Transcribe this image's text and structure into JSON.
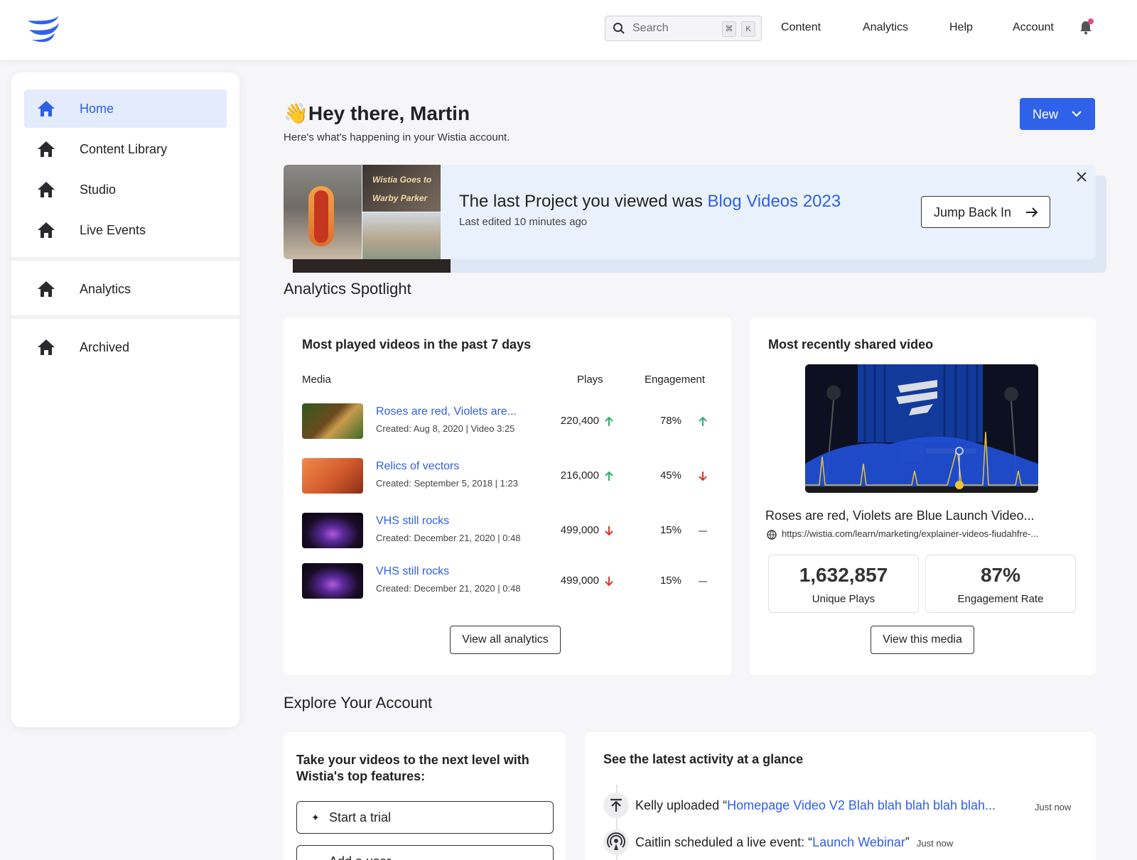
{
  "header": {
    "search": {
      "placeholder": "Search",
      "key1": "⌘",
      "key2": "K"
    },
    "nav": [
      "Content",
      "Analytics",
      "Help",
      "Account"
    ],
    "icons": [
      "wistia-logo-icon",
      "search-icon",
      "bell-icon"
    ]
  },
  "sidebar": {
    "items": [
      {
        "label": "Home",
        "active": true
      },
      {
        "label": "Content Library"
      },
      {
        "label": "Studio"
      },
      {
        "label": "Live Events"
      },
      {
        "label": "Analytics"
      },
      {
        "label": "Archived"
      }
    ]
  },
  "greeting": {
    "emoji": "👋",
    "title": "Hey there, Martin",
    "subtitle": "Here's what's happening in your Wistia account.",
    "new_label": "New"
  },
  "banner": {
    "text": "The last Project you viewed was ",
    "project_link": "Blog Videos 2023",
    "edited": "Last edited 10 minutes ago",
    "button": "Jump Back In",
    "thumb_caption": "Wistia Goes to Warby Parker"
  },
  "analytics": {
    "heading": "Analytics Spotlight",
    "most_played": {
      "title": "Most played videos in the past 7 days",
      "col_media": "Media",
      "col_plays": "Plays",
      "col_engagement": "Engagement",
      "rows": [
        {
          "title": "Roses are red, Violets are...",
          "meta": "Created: Aug 8, 2020 | Video 3:25",
          "plays": "220,400",
          "plays_trend": "up",
          "engagement": "78%",
          "eng_trend": "up"
        },
        {
          "title": "Relics of vectors",
          "meta": "Created: September 5, 2018 | 1:23",
          "plays": "216,000",
          "plays_trend": "up",
          "engagement": "45%",
          "eng_trend": "down"
        },
        {
          "title": "VHS still rocks",
          "meta": "Created: December 21, 2020 | 0:48",
          "plays": "499,000",
          "plays_trend": "down",
          "engagement": "15%",
          "eng_trend": "flat"
        },
        {
          "title": "VHS still rocks",
          "meta": "Created: December 21, 2020 | 0:48",
          "plays": "499,000",
          "plays_trend": "down",
          "engagement": "15%",
          "eng_trend": "flat"
        }
      ],
      "button": "View all analytics"
    },
    "recent_shared": {
      "title": "Most recently shared video",
      "video_title": "Roses are red, Violets are Blue Launch Video...",
      "url": "https://wistia.com/learn/marketing/explainer-videos-fiudahfre-...",
      "stats": [
        {
          "value": "1,632,857",
          "label": "Unique Plays"
        },
        {
          "value": "87%",
          "label": "Engagement Rate"
        }
      ],
      "button": "View this media"
    }
  },
  "explore": {
    "heading": "Explore Your Account",
    "features": {
      "title": "Take your videos to the next level with Wistia's top features:",
      "buttons": [
        "Start a trial",
        "Add a user"
      ]
    },
    "activity": {
      "title": "See the latest activity at a glance",
      "items": [
        {
          "prefix": "Kelly uploaded “",
          "link": "Homepage Video V2 Blah blah blah blah blah...",
          "suffix": "",
          "time": "Just now"
        },
        {
          "prefix": "Caitlin scheduled a live event: “",
          "link": "Launch Webinar",
          "suffix": "”",
          "time": "Just now"
        }
      ]
    }
  },
  "colors": {
    "accent": "#2f62e8",
    "link": "#2f5fe3",
    "up": "#2fae63",
    "down": "#d9362b"
  }
}
